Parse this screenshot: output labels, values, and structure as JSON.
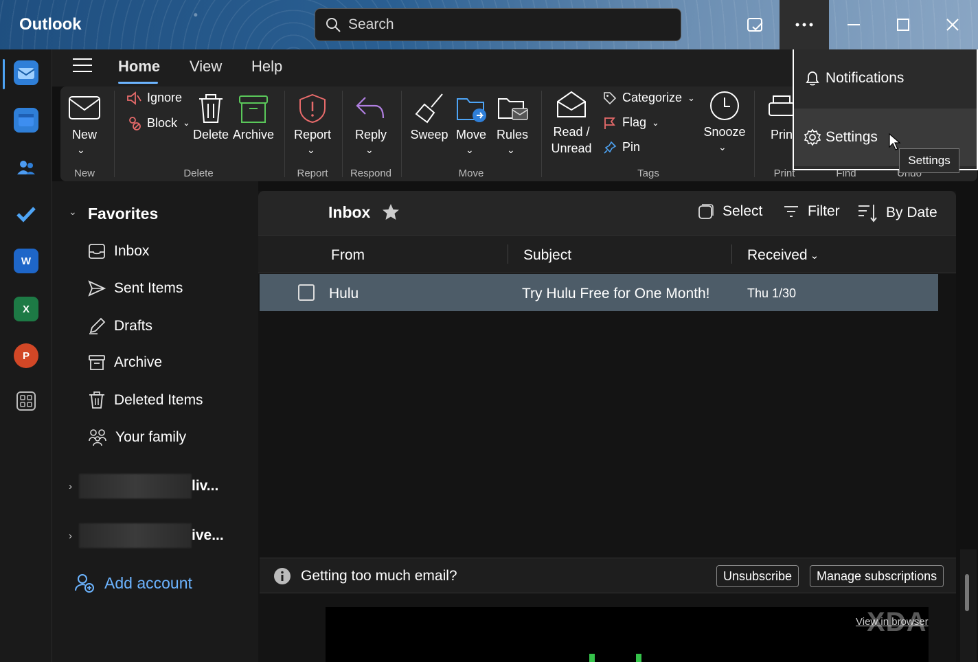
{
  "app": {
    "title": "Outlook"
  },
  "search": {
    "placeholder": "Search"
  },
  "tabs": [
    {
      "label": "Home"
    },
    {
      "label": "View"
    },
    {
      "label": "Help"
    }
  ],
  "ribbon": {
    "new": {
      "label": "New",
      "group": "New"
    },
    "delete_group": {
      "ignore": "Ignore",
      "block": "Block",
      "delete": "Delete",
      "archive": "Archive",
      "group": "Delete"
    },
    "report": {
      "label": "Report",
      "group": "Report"
    },
    "respond": {
      "reply": "Reply",
      "group": "Respond"
    },
    "move_group": {
      "sweep": "Sweep",
      "move": "Move",
      "rules": "Rules",
      "group": "Move"
    },
    "tags": {
      "read_unread_1": "Read /",
      "read_unread_2": "Unread",
      "categorize": "Categorize",
      "flag": "Flag",
      "pin": "Pin",
      "snooze": "Snooze",
      "group": "Tags"
    },
    "print": {
      "label": "Prin",
      "group": "Print"
    },
    "find_group": "Find",
    "undo_group": "Undo"
  },
  "menu": {
    "notifications": "Notifications",
    "settings": "Settings",
    "tooltip": "Settings"
  },
  "folders": {
    "favorites_label": "Favorites",
    "items": [
      {
        "label": "Inbox",
        "icon": "inbox-icon"
      },
      {
        "label": "Sent Items",
        "icon": "send-icon"
      },
      {
        "label": "Drafts",
        "icon": "pencil-icon"
      },
      {
        "label": "Archive",
        "icon": "archive-icon"
      },
      {
        "label": "Deleted Items",
        "icon": "trash-icon"
      },
      {
        "label": "Your family",
        "icon": "family-icon"
      }
    ],
    "accounts": [
      {
        "suffix": "liv..."
      },
      {
        "suffix": "ive..."
      }
    ],
    "add_account": "Add account"
  },
  "list": {
    "title": "Inbox",
    "select": "Select",
    "filter": "Filter",
    "sort": "By Date",
    "columns": {
      "from": "From",
      "subject": "Subject",
      "received": "Received"
    },
    "rows": [
      {
        "from": "Hulu",
        "subject": "Try Hulu Free for One Month!",
        "received": "Thu 1/30"
      }
    ]
  },
  "banner": {
    "text": "Getting too much email?",
    "unsubscribe": "Unsubscribe",
    "manage": "Manage subscriptions"
  },
  "preview": {
    "view_in_browser": "View in browser"
  },
  "watermark": "XDA",
  "colors": {
    "accent": "#6cb4ff",
    "selected_row": "#4d5c68",
    "titlebar": "#2a5f92"
  }
}
